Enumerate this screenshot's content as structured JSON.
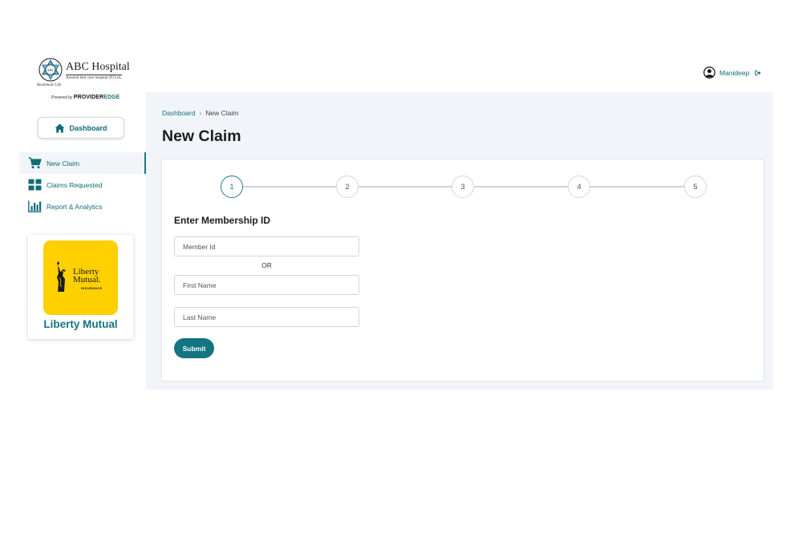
{
  "brand": {
    "name": "ABC Hospital",
    "subtitle": "Assured best care hospital (P) Ltd.,",
    "tagline": "Reanimate Life",
    "mark_text": "ABC",
    "powered_by_label": "Powered by",
    "powered_by_brand_a": "PROVIDER",
    "powered_by_brand_b": "EDGE"
  },
  "sidebar": {
    "dashboard_label": "Dashboard",
    "items": [
      {
        "label": "New Claim",
        "icon": "cart-icon",
        "active": true
      },
      {
        "label": "Claims Requested",
        "icon": "grid-icon",
        "active": false
      },
      {
        "label": "Report & Analytics",
        "icon": "bar-chart-icon",
        "active": false
      }
    ],
    "insurer": {
      "logo_line1": "Liberty",
      "logo_line2": "Mutual.",
      "logo_line3": "INSURANCE",
      "name": "Liberty Mutual"
    }
  },
  "header": {
    "user_name": "Manideep"
  },
  "breadcrumb": {
    "home": "Dashboard",
    "separator": "›",
    "current": "New Claim"
  },
  "page": {
    "title": "New Claim"
  },
  "stepper": {
    "steps": [
      "1",
      "2",
      "3",
      "4",
      "5"
    ],
    "active_step": 1
  },
  "form": {
    "title": "Enter Membership ID",
    "member_id_placeholder": "Member Id",
    "or_label": "OR",
    "first_name_placeholder": "First Name",
    "last_name_placeholder": "Last Name",
    "submit_label": "Submit"
  },
  "colors": {
    "accent": "#137580",
    "background_panel": "#f1f5fa",
    "insurer_yellow": "#ffd000"
  }
}
